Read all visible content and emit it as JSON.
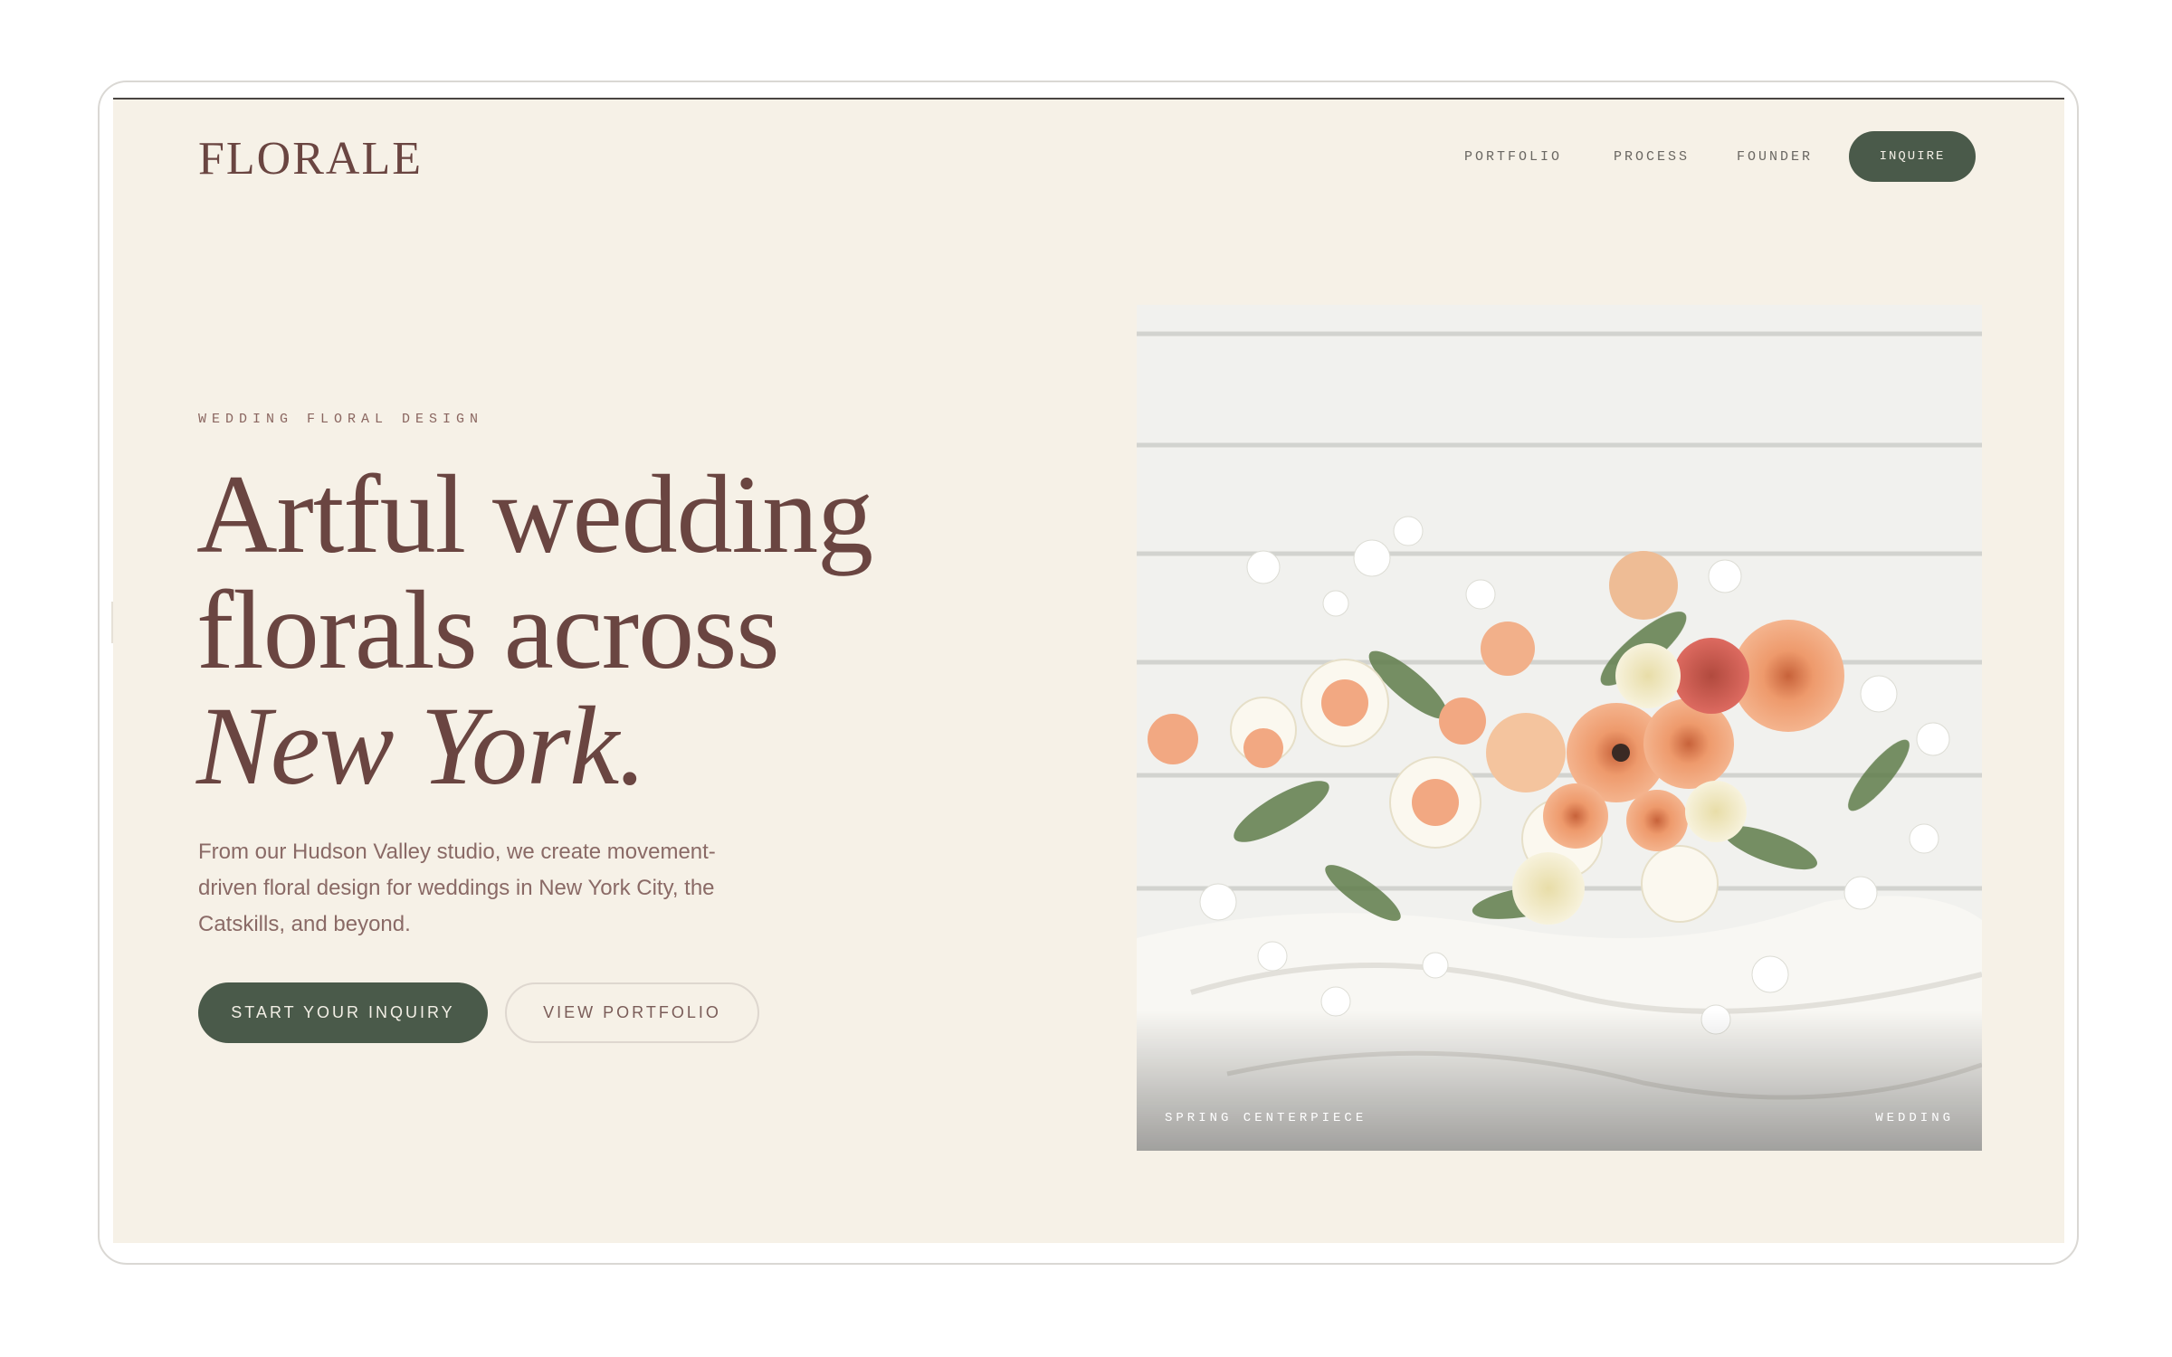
{
  "brand": {
    "logo_text": "FLORALE"
  },
  "nav": {
    "items": [
      {
        "label": "PORTFOLIO"
      },
      {
        "label": "PROCESS"
      },
      {
        "label": "FOUNDER"
      }
    ],
    "cta_label": "INQUIRE"
  },
  "hero": {
    "eyebrow": "WEDDING FLORAL DESIGN",
    "headline_line1": "Artful wedding",
    "headline_line2": "florals across",
    "headline_line3": "New York.",
    "lede": "From our Hudson Valley studio, we create movement-driven floral design for weddings in New York City, the Catskills, and beyond.",
    "primary_cta": "START YOUR INQUIRY",
    "secondary_cta": "VIEW PORTFOLIO"
  },
  "photo": {
    "caption_left": "SPRING CENTERPIECE",
    "caption_right": "WEDDING"
  },
  "colors": {
    "background": "#f6f1e7",
    "accent_green": "#4a5a4a",
    "text_burgundy": "#6a4541"
  }
}
